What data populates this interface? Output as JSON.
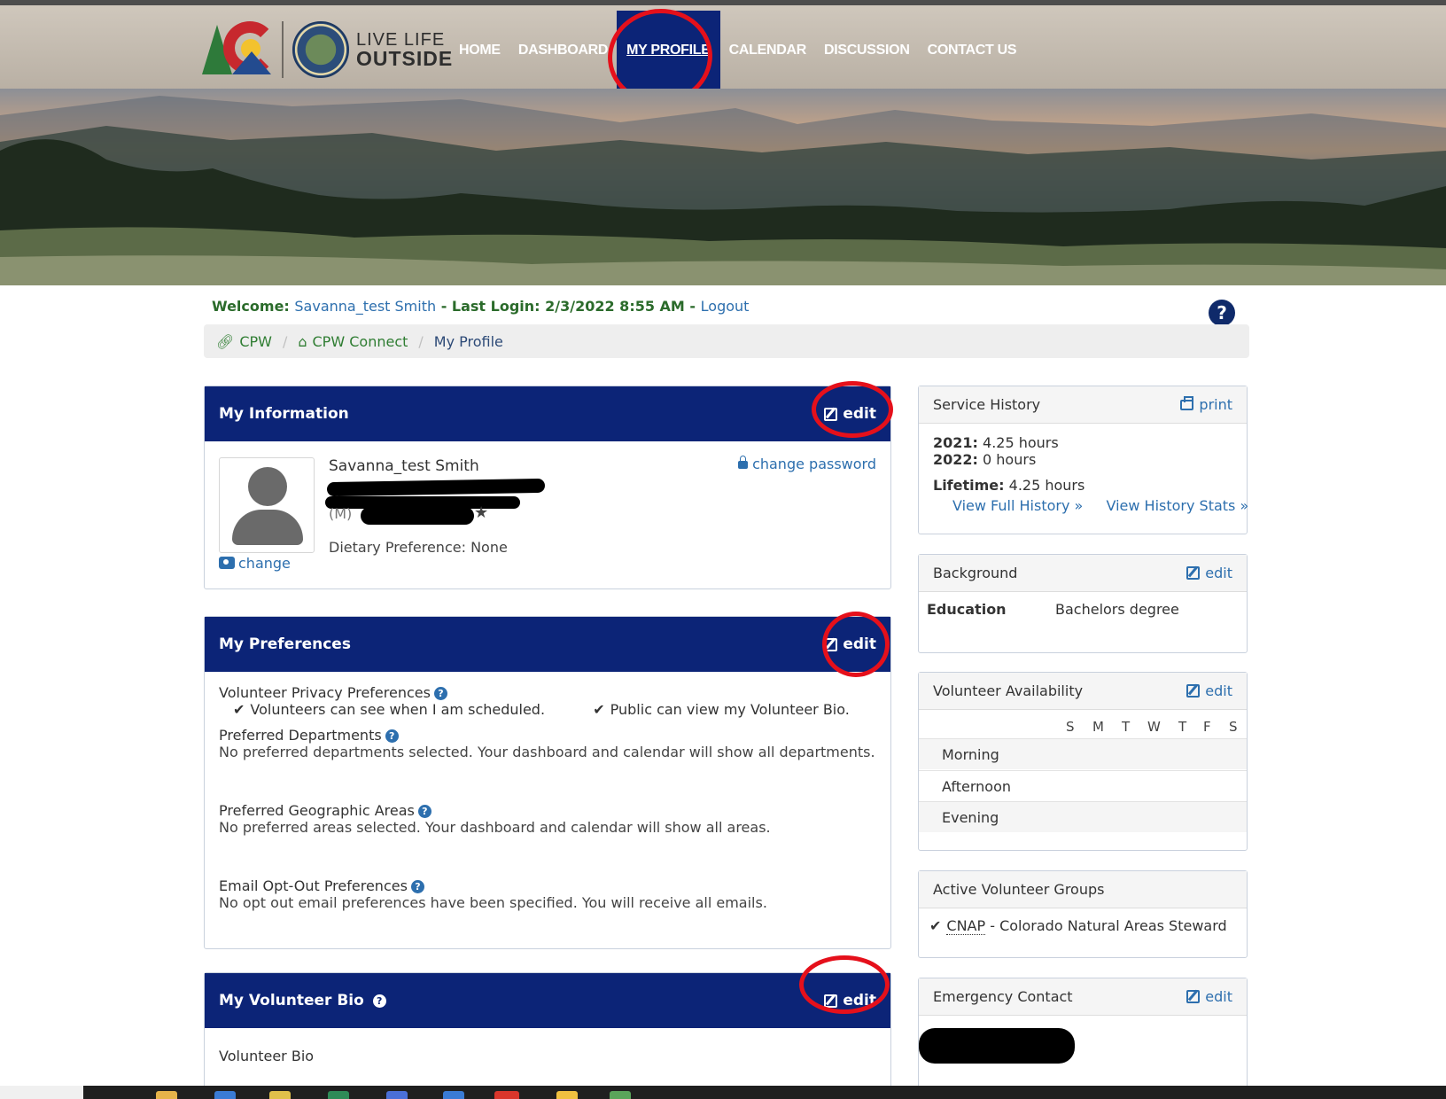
{
  "logo": {
    "line1": "LIVE LIFE",
    "line2": "OUTSIDE"
  },
  "nav": {
    "items": [
      {
        "label": "HOME"
      },
      {
        "label": "DASHBOARD"
      },
      {
        "label": "MY PROFILE"
      },
      {
        "label": "CALENDAR"
      },
      {
        "label": "DISCUSSION"
      },
      {
        "label": "CONTACT US"
      }
    ]
  },
  "welcome": {
    "prefix": "Welcome: ",
    "name": "Savanna_test Smith",
    "last_login_label": " - Last Login: ",
    "last_login_value": "2/3/2022 8:55 AM",
    "dash": " - ",
    "logout": "Logout"
  },
  "help": {
    "glyph": "?"
  },
  "breadcrumb": {
    "items": [
      {
        "label": "CPW"
      },
      {
        "label": "CPW Connect"
      },
      {
        "label": "My Profile"
      }
    ],
    "separator": "/"
  },
  "my_information": {
    "title": "My Information",
    "edit": "edit",
    "name": "Savanna_test Smith",
    "phone_prefix": "(M)",
    "dietary": "Dietary Preference: None",
    "change_password": "change password",
    "change_photo": "change"
  },
  "my_preferences": {
    "title": "My Preferences",
    "edit": "edit",
    "privacy_title": "Volunteer Privacy Preferences",
    "privacy_opt1": "Volunteers can see when I am scheduled.",
    "privacy_opt2": "Public can view my Volunteer Bio.",
    "departments_title": "Preferred Departments",
    "departments_desc": "No preferred departments selected. Your dashboard and calendar will show all departments.",
    "geo_title": "Preferred Geographic Areas",
    "geo_desc": "No preferred areas selected. Your dashboard and calendar will show all areas.",
    "email_title": "Email Opt-Out Preferences",
    "email_desc": "No opt out email preferences have been specified. You will receive all emails."
  },
  "volunteer_bio": {
    "title": "My Volunteer Bio",
    "edit": "edit",
    "body": "Volunteer Bio"
  },
  "service_history": {
    "title": "Service History",
    "print": "print",
    "y2021_label": "2021:",
    "y2021_value": " 4.25 hours",
    "y2022_label": "2022:",
    "y2022_value": " 0 hours",
    "lifetime_label": "Lifetime:",
    "lifetime_value": " 4.25 hours",
    "view_full": "View Full History »",
    "view_stats": "View History Stats »"
  },
  "background": {
    "title": "Background",
    "edit": "edit",
    "education_label": "Education",
    "education_value": "Bachelors degree"
  },
  "availability": {
    "title": "Volunteer Availability",
    "edit": "edit",
    "days": [
      "S",
      "M",
      "T",
      "W",
      "T",
      "F",
      "S"
    ],
    "rows": [
      "Morning",
      "Afternoon",
      "Evening"
    ]
  },
  "groups": {
    "title": "Active Volunteer Groups",
    "item_abbr": "CNAP",
    "item_rest": " - Colorado Natural Areas Steward"
  },
  "emergency": {
    "title": "Emergency Contact",
    "edit": "edit"
  },
  "colors": {
    "nav_active": "#0c2477",
    "panel_header": "#0c2477",
    "link": "#2d6fae",
    "welcome_green": "#2b6b2b",
    "annotation_red": "#e5101b"
  }
}
